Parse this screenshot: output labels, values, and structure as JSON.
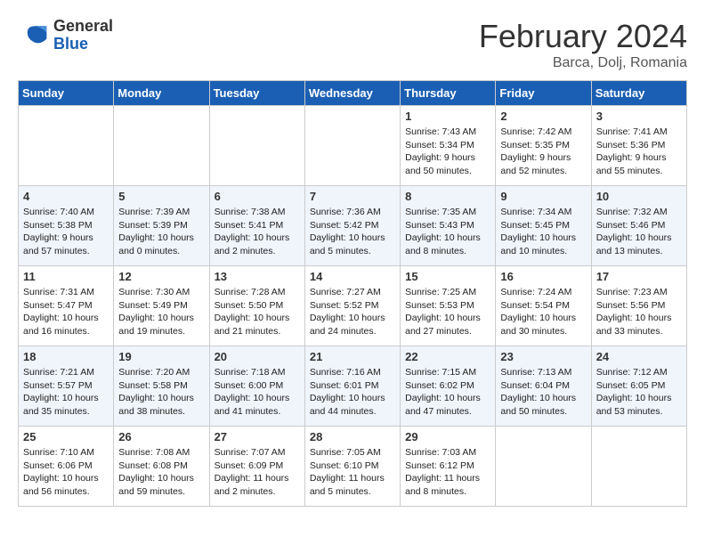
{
  "header": {
    "logo_general": "General",
    "logo_blue": "Blue",
    "month_title": "February 2024",
    "location": "Barca, Dolj, Romania"
  },
  "calendar": {
    "days_of_week": [
      "Sunday",
      "Monday",
      "Tuesday",
      "Wednesday",
      "Thursday",
      "Friday",
      "Saturday"
    ],
    "weeks": [
      [
        {
          "day": "",
          "info": ""
        },
        {
          "day": "",
          "info": ""
        },
        {
          "day": "",
          "info": ""
        },
        {
          "day": "",
          "info": ""
        },
        {
          "day": "1",
          "info": "Sunrise: 7:43 AM\nSunset: 5:34 PM\nDaylight: 9 hours\nand 50 minutes."
        },
        {
          "day": "2",
          "info": "Sunrise: 7:42 AM\nSunset: 5:35 PM\nDaylight: 9 hours\nand 52 minutes."
        },
        {
          "day": "3",
          "info": "Sunrise: 7:41 AM\nSunset: 5:36 PM\nDaylight: 9 hours\nand 55 minutes."
        }
      ],
      [
        {
          "day": "4",
          "info": "Sunrise: 7:40 AM\nSunset: 5:38 PM\nDaylight: 9 hours\nand 57 minutes."
        },
        {
          "day": "5",
          "info": "Sunrise: 7:39 AM\nSunset: 5:39 PM\nDaylight: 10 hours\nand 0 minutes."
        },
        {
          "day": "6",
          "info": "Sunrise: 7:38 AM\nSunset: 5:41 PM\nDaylight: 10 hours\nand 2 minutes."
        },
        {
          "day": "7",
          "info": "Sunrise: 7:36 AM\nSunset: 5:42 PM\nDaylight: 10 hours\nand 5 minutes."
        },
        {
          "day": "8",
          "info": "Sunrise: 7:35 AM\nSunset: 5:43 PM\nDaylight: 10 hours\nand 8 minutes."
        },
        {
          "day": "9",
          "info": "Sunrise: 7:34 AM\nSunset: 5:45 PM\nDaylight: 10 hours\nand 10 minutes."
        },
        {
          "day": "10",
          "info": "Sunrise: 7:32 AM\nSunset: 5:46 PM\nDaylight: 10 hours\nand 13 minutes."
        }
      ],
      [
        {
          "day": "11",
          "info": "Sunrise: 7:31 AM\nSunset: 5:47 PM\nDaylight: 10 hours\nand 16 minutes."
        },
        {
          "day": "12",
          "info": "Sunrise: 7:30 AM\nSunset: 5:49 PM\nDaylight: 10 hours\nand 19 minutes."
        },
        {
          "day": "13",
          "info": "Sunrise: 7:28 AM\nSunset: 5:50 PM\nDaylight: 10 hours\nand 21 minutes."
        },
        {
          "day": "14",
          "info": "Sunrise: 7:27 AM\nSunset: 5:52 PM\nDaylight: 10 hours\nand 24 minutes."
        },
        {
          "day": "15",
          "info": "Sunrise: 7:25 AM\nSunset: 5:53 PM\nDaylight: 10 hours\nand 27 minutes."
        },
        {
          "day": "16",
          "info": "Sunrise: 7:24 AM\nSunset: 5:54 PM\nDaylight: 10 hours\nand 30 minutes."
        },
        {
          "day": "17",
          "info": "Sunrise: 7:23 AM\nSunset: 5:56 PM\nDaylight: 10 hours\nand 33 minutes."
        }
      ],
      [
        {
          "day": "18",
          "info": "Sunrise: 7:21 AM\nSunset: 5:57 PM\nDaylight: 10 hours\nand 35 minutes."
        },
        {
          "day": "19",
          "info": "Sunrise: 7:20 AM\nSunset: 5:58 PM\nDaylight: 10 hours\nand 38 minutes."
        },
        {
          "day": "20",
          "info": "Sunrise: 7:18 AM\nSunset: 6:00 PM\nDaylight: 10 hours\nand 41 minutes."
        },
        {
          "day": "21",
          "info": "Sunrise: 7:16 AM\nSunset: 6:01 PM\nDaylight: 10 hours\nand 44 minutes."
        },
        {
          "day": "22",
          "info": "Sunrise: 7:15 AM\nSunset: 6:02 PM\nDaylight: 10 hours\nand 47 minutes."
        },
        {
          "day": "23",
          "info": "Sunrise: 7:13 AM\nSunset: 6:04 PM\nDaylight: 10 hours\nand 50 minutes."
        },
        {
          "day": "24",
          "info": "Sunrise: 7:12 AM\nSunset: 6:05 PM\nDaylight: 10 hours\nand 53 minutes."
        }
      ],
      [
        {
          "day": "25",
          "info": "Sunrise: 7:10 AM\nSunset: 6:06 PM\nDaylight: 10 hours\nand 56 minutes."
        },
        {
          "day": "26",
          "info": "Sunrise: 7:08 AM\nSunset: 6:08 PM\nDaylight: 10 hours\nand 59 minutes."
        },
        {
          "day": "27",
          "info": "Sunrise: 7:07 AM\nSunset: 6:09 PM\nDaylight: 11 hours\nand 2 minutes."
        },
        {
          "day": "28",
          "info": "Sunrise: 7:05 AM\nSunset: 6:10 PM\nDaylight: 11 hours\nand 5 minutes."
        },
        {
          "day": "29",
          "info": "Sunrise: 7:03 AM\nSunset: 6:12 PM\nDaylight: 11 hours\nand 8 minutes."
        },
        {
          "day": "",
          "info": ""
        },
        {
          "day": "",
          "info": ""
        }
      ]
    ]
  }
}
